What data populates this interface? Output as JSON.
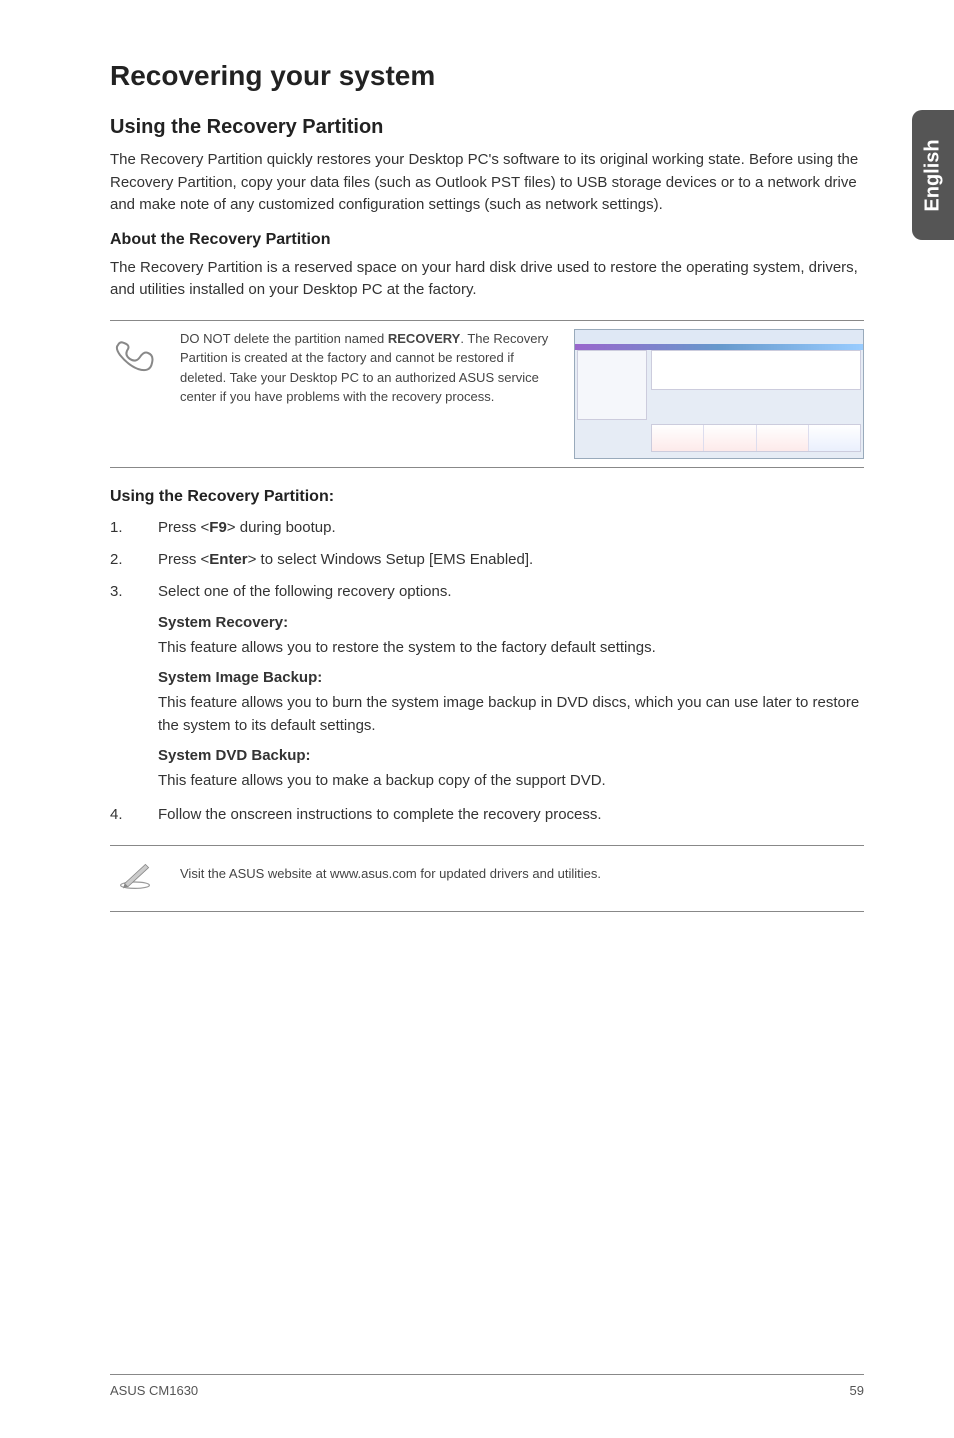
{
  "side_tab": "English",
  "h1": "Recovering your system",
  "h2": "Using the Recovery Partition",
  "intro": "The Recovery Partition quickly restores your Desktop PC's software to its original working state. Before using the Recovery Partition, copy your data files (such as Outlook PST files) to USB storage devices or to a network drive and make note of any customized configuration settings (such as network settings).",
  "h3_about": "About the Recovery Partition",
  "about_text": "The Recovery Partition is a reserved space on your hard disk drive used to restore the operating system, drivers, and utilities installed on your Desktop PC at the factory.",
  "note1_pre": "DO NOT delete the partition named ",
  "note1_bold": "RECOVERY",
  "note1_post": ". The Recovery Partition is created at the factory and cannot be restored if deleted. Take your Desktop PC to an authorized ASUS service center if you have problems with the recovery process.",
  "h3_using": "Using the Recovery Partition:",
  "step1_pre": "Press <",
  "step1_bold": "F9",
  "step1_post": "> during bootup.",
  "step2_pre": "Press <",
  "step2_bold": "Enter",
  "step2_post": "> to select Windows Setup [EMS Enabled].",
  "step3": "Select one of the following recovery options.",
  "sr_title": "System Recovery:",
  "sr_text": "This feature allows you to restore the system to the factory default settings.",
  "sib_title": "System Image Backup:",
  "sib_text": "This feature allows you to burn the system image backup in DVD discs, which you can use later to restore the system to its default settings.",
  "sdb_title": "System DVD Backup:",
  "sdb_text": "This feature allows you to make a backup copy of the support DVD.",
  "step4": "Follow the onscreen instructions to complete the recovery process.",
  "note2": "Visit the ASUS website at www.asus.com for updated drivers and utilities.",
  "footer_left": "ASUS CM1630",
  "footer_right": "59"
}
